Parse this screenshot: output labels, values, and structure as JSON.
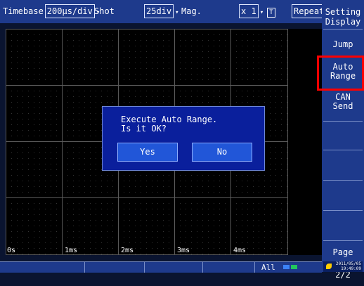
{
  "topbar": {
    "timebase_label": "Timebase",
    "timebase_value": "200µs/div",
    "shot_label": "Shot",
    "shot_value": "25div",
    "mag_label": "Mag.",
    "mag_value": "x 1",
    "trigger_icon": "T",
    "mode_value": "Repeat"
  },
  "sidebar": {
    "setting_line1": "Setting",
    "setting_line2": "Display",
    "jump": "Jump",
    "auto_range_line1": "Auto",
    "auto_range_line2": "Range",
    "can_line1": "CAN",
    "can_line2": "Send",
    "page": "Page 2/2"
  },
  "plot": {
    "x_ticks": [
      "0s",
      "1ms",
      "2ms",
      "3ms",
      "4ms"
    ]
  },
  "dialog": {
    "line1": "Execute Auto Range.",
    "line2": "Is it OK?",
    "yes": "Yes",
    "no": "No"
  },
  "statusbar": {
    "channel": "All",
    "date": "2011/05/05",
    "time": "19:49:09"
  },
  "colors": {
    "panel_blue": "#1e3a8c",
    "dialog_blue": "#0a1f9c",
    "highlight_red": "#ff0000"
  }
}
